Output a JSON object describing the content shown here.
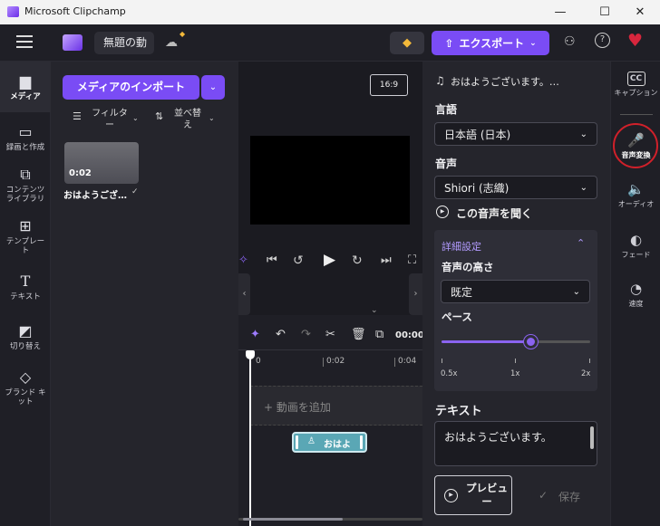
{
  "window": {
    "title": "Microsoft Clipchamp",
    "minimize": "—",
    "maximize": "☐",
    "close": "✕"
  },
  "topbar": {
    "project_name": "無題の動",
    "export_label": "エクスポート"
  },
  "leftnav": {
    "items": [
      {
        "label": "メディア",
        "icon": "folder-icon",
        "glyph": "▆"
      },
      {
        "label": "録画と作成",
        "icon": "camera-icon",
        "glyph": "▭"
      },
      {
        "label": "コンテンツライブラリ",
        "icon": "library-icon",
        "glyph": "⧉"
      },
      {
        "label": "テンプレート",
        "icon": "template-icon",
        "glyph": "⊞"
      },
      {
        "label": "テキスト",
        "icon": "text-icon",
        "glyph": "T"
      },
      {
        "label": "切り替え",
        "icon": "transition-icon",
        "glyph": "◩"
      },
      {
        "label": "ブランド キット",
        "icon": "brand-kit-icon",
        "glyph": "◇"
      }
    ]
  },
  "media": {
    "import_label": "メディアのインポート",
    "filter_label": "フィルター",
    "sort_label": "並べ替え",
    "clip_duration": "0:02",
    "clip_name": "おはようござ…"
  },
  "preview": {
    "aspect": "16:9"
  },
  "timeline": {
    "time": "00:00",
    "tick_0": "0",
    "tick_1": "0:02",
    "tick_2": "0:04",
    "add_video": "+ 動画を追加",
    "clip_label": "おはよ"
  },
  "rightpanel": {
    "header": "おはようございます。…",
    "language_label": "言語",
    "language_value": "日本語 (日本)",
    "voice_label": "音声",
    "voice_value": "Shiori (志織)",
    "listen_label": "この音声を聞く",
    "advanced_label": "詳細設定",
    "pitch_label": "音声の高さ",
    "pitch_value": "既定",
    "pace_label": "ペース",
    "pace_ticks": [
      "0.5x",
      "1x",
      "2x"
    ],
    "pace_value": 1.2,
    "text_label": "テキスト",
    "text_value": "おはようございます。",
    "preview_label": "プレビュー",
    "save_label": "保存"
  },
  "rightnav": {
    "items": [
      {
        "label": "キャプション",
        "icon": "captions-icon",
        "glyph": "CC"
      },
      {
        "label": "音声変換",
        "icon": "voice-icon",
        "glyph": "🎤"
      },
      {
        "label": "オーディオ",
        "icon": "speaker-icon",
        "glyph": "🔈"
      },
      {
        "label": "フェード",
        "icon": "fade-icon",
        "glyph": "◐"
      },
      {
        "label": "速度",
        "icon": "speed-icon",
        "glyph": "◔"
      }
    ]
  },
  "colors": {
    "accent": "#7a4cf5",
    "highlight_ring": "#d0202a"
  }
}
